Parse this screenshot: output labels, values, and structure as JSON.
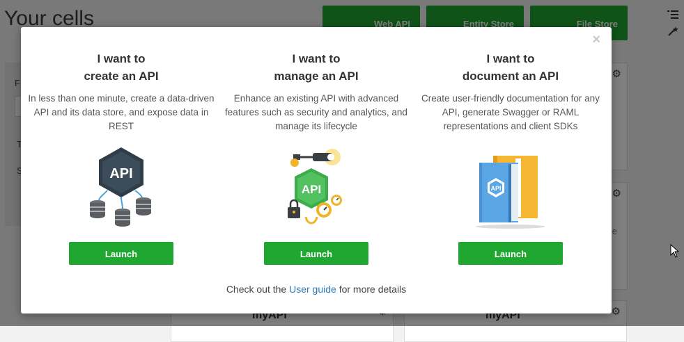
{
  "app": {
    "page_title": "Your cells",
    "top_buttons": {
      "web_api": "Web API",
      "entity_store": "Entity Store",
      "file_store": "File Store"
    },
    "left_panel": {
      "filter_label": "F",
      "item_t": "T",
      "item_s": "S"
    },
    "cards": {
      "bottom_left_title": "myAPI",
      "bottom_right_title": "myAPI",
      "side_fragment": "e"
    },
    "colors": {
      "accent_green": "#1fa731",
      "link_blue": "#2b7bb9",
      "overlay": "rgba(0,0,0,0.5)"
    }
  },
  "modal": {
    "close_symbol": "×",
    "columns": [
      {
        "heading_line1": "I want to",
        "heading_line2": "create an API",
        "description": "In less than one minute, create a data-driven API and its data store, and expose data in REST",
        "illustration": "api-hexagon-with-databases-icon",
        "button_label": "Launch"
      },
      {
        "heading_line1": "I want to",
        "heading_line2": "manage an API",
        "description": "Enhance an existing API with advanced features such as security and analytics, and manage its lifecycle",
        "illustration": "api-shield-with-camera-lock-gauges-icon",
        "button_label": "Launch"
      },
      {
        "heading_line1": "I want to",
        "heading_line2": "document an API",
        "description": "Create user-friendly documentation for any API, generate Swagger or RAML representations and client SDKs",
        "illustration": "api-documentation-books-icon",
        "button_label": "Launch"
      }
    ],
    "footer": {
      "prefix": "Check out the",
      "link_text": "User guide",
      "suffix": "for more details"
    }
  }
}
